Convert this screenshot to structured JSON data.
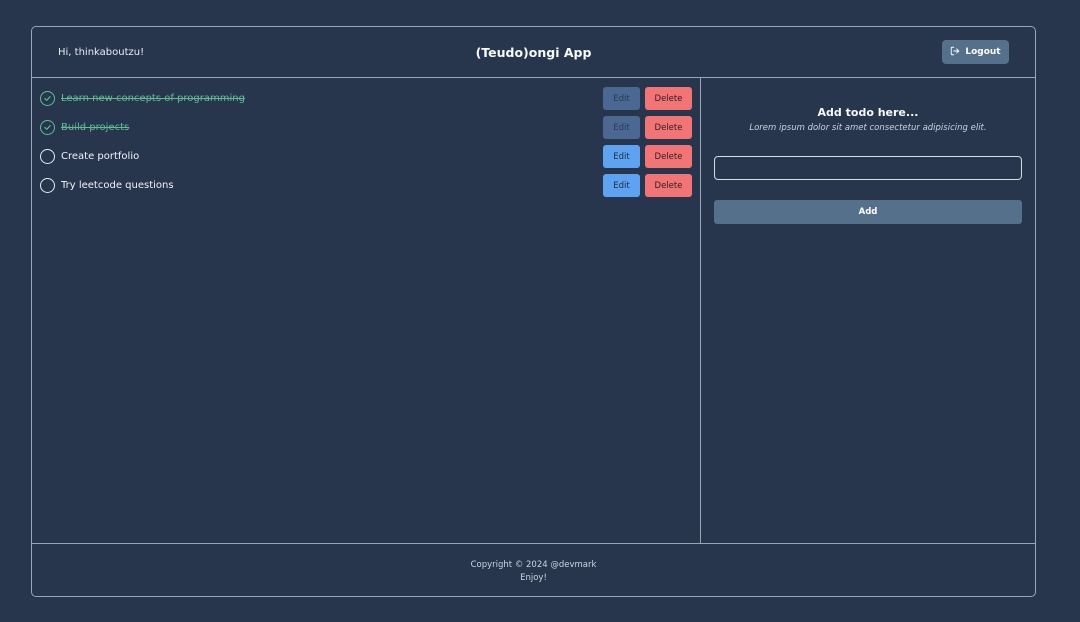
{
  "header": {
    "greeting": "Hi, thinkaboutzu!",
    "title": "(Teudo)ongi App",
    "logout_label": "Logout"
  },
  "todos": [
    {
      "text": "Learn new concepts of programming",
      "done": true,
      "edit_label": "Edit",
      "delete_label": "Delete"
    },
    {
      "text": "Build projects",
      "done": true,
      "edit_label": "Edit",
      "delete_label": "Delete"
    },
    {
      "text": "Create portfolio",
      "done": false,
      "edit_label": "Edit",
      "delete_label": "Delete"
    },
    {
      "text": "Try leetcode questions",
      "done": false,
      "edit_label": "Edit",
      "delete_label": "Delete"
    }
  ],
  "side": {
    "title": "Add todo here...",
    "subtitle": "Lorem ipsum dolor sit amet consectetur adipisicing elit.",
    "input_value": "",
    "add_label": "Add"
  },
  "footer": {
    "copyright": "Copyright © 2024 @devmark",
    "tagline": "Enjoy!"
  },
  "icons": {
    "logout": "logout-icon",
    "check_done": "check-circle-icon",
    "check_open": "empty-circle-icon"
  },
  "colors": {
    "background": "#27354d",
    "done_green": "#5fbf93",
    "edit_blue": "#5ea3f2",
    "delete_red": "#f27474",
    "slate_button": "#55708a"
  }
}
